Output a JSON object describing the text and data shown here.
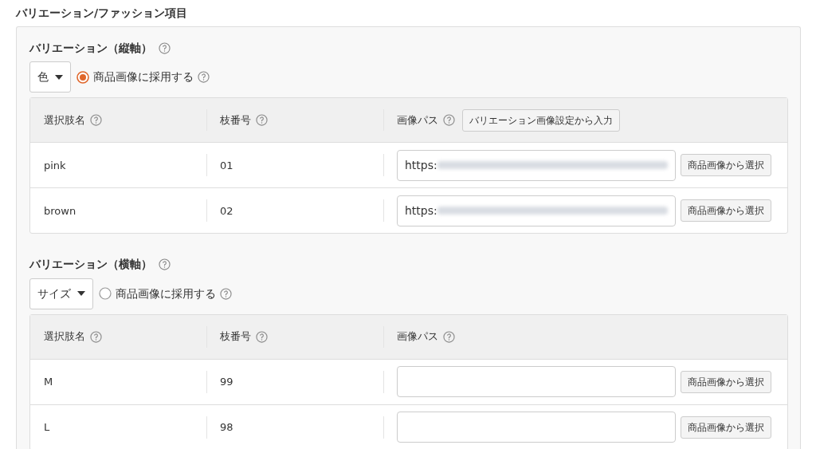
{
  "title": "バリエーション/ファッション項目",
  "sections": [
    {
      "heading": "バリエーション（縦軸）",
      "select_value": "色",
      "use_for_images": {
        "label": "商品画像に採用する",
        "selected": true
      },
      "columns": [
        {
          "label": "選択肢名"
        },
        {
          "label": "枝番号"
        },
        {
          "label": "画像パス",
          "button": "バリエーション画像設定から入力"
        }
      ],
      "rows": [
        {
          "name": "pink",
          "number": "01",
          "path": "https:",
          "blurred": true,
          "button": "商品画像から選択"
        },
        {
          "name": "brown",
          "number": "02",
          "path": "https:",
          "blurred": true,
          "button": "商品画像から選択"
        }
      ]
    },
    {
      "heading": "バリエーション（横軸）",
      "select_value": "サイズ",
      "use_for_images": {
        "label": "商品画像に採用する",
        "selected": false
      },
      "columns": [
        {
          "label": "選択肢名"
        },
        {
          "label": "枝番号"
        },
        {
          "label": "画像パス"
        }
      ],
      "rows": [
        {
          "name": "M",
          "number": "99",
          "blurred": false,
          "button": "商品画像から選択"
        },
        {
          "name": "L",
          "number": "98",
          "blurred": false,
          "button": "商品画像から選択"
        }
      ]
    }
  ]
}
